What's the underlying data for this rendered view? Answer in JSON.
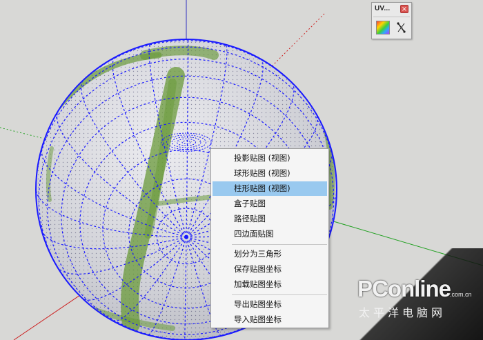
{
  "uv_toolbar": {
    "title": "UV...",
    "close_label": "×",
    "tools": [
      {
        "name": "color-texture-icon"
      },
      {
        "name": "uv-pin-tool-icon"
      }
    ]
  },
  "context_menu": {
    "groups": [
      [
        {
          "label": "投影贴图 (视图)"
        },
        {
          "label": "球形贴图 (视图)"
        },
        {
          "label": "柱形贴图 (视图)",
          "highlighted": true
        },
        {
          "label": "盒子贴图"
        },
        {
          "label": "路径贴图"
        },
        {
          "label": "四边面贴图"
        }
      ],
      [
        {
          "label": "划分为三角形"
        },
        {
          "label": "保存贴图坐标"
        },
        {
          "label": "加载贴图坐标"
        }
      ],
      [
        {
          "label": "导出贴图坐标"
        },
        {
          "label": "导入贴图坐标"
        }
      ]
    ]
  },
  "watermark": {
    "logo": "PConline",
    "domain": ".com.cn",
    "chinese": "太平洋电脑网"
  },
  "colors": {
    "viewport_bg": "#d8d8d6",
    "mesh_blue": "#1a1aff",
    "menu_highlight": "#99c9ef",
    "axis_red": "#cc2020",
    "axis_green": "#20a020",
    "axis_blue": "#3030c0",
    "texture_green": "#6a9a3a"
  }
}
